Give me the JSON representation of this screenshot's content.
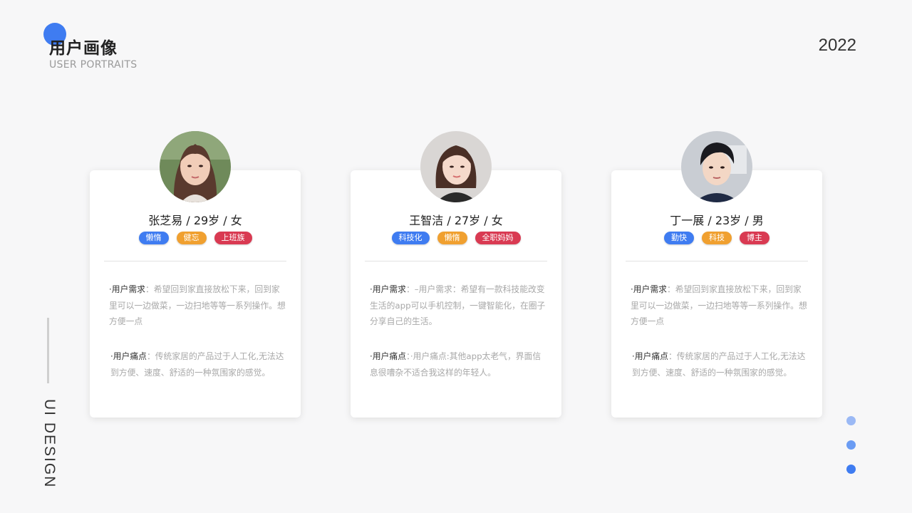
{
  "header": {
    "title": "用户画像",
    "subtitle": "USER PORTRAITS",
    "year": "2022",
    "accent_color": "#3f7cf1"
  },
  "side": {
    "label": "UI DESIGN"
  },
  "nav_dots": [
    {
      "color": "#9bb9f5"
    },
    {
      "color": "#6b9cf3"
    },
    {
      "color": "#3f7cf1"
    }
  ],
  "cards": [
    {
      "name": "张芝易 / 29岁 / 女",
      "avatar": "portrait-woman-long-hair",
      "tags": [
        {
          "label": "懒惰",
          "color": "#3f7cf1"
        },
        {
          "label": "健忘",
          "color": "#f0a030"
        },
        {
          "label": "上班族",
          "color": "#d93a52"
        }
      ],
      "needs": {
        "label": "·用户需求",
        "text": "：希望回到家直接放松下来，回到家里可以一边做菜，一边扫地等等一系列操作。想方便一点"
      },
      "pain": {
        "label": "·用户痛点",
        "text": "：传统家居的产品过于人工化,无法达到方便、速度、舒适的一种氛围家的感觉。"
      }
    },
    {
      "name": "王智洁 / 27岁 / 女",
      "avatar": "portrait-woman-short-hair",
      "tags": [
        {
          "label": "科技化",
          "color": "#3f7cf1"
        },
        {
          "label": "懒惰",
          "color": "#f0a030"
        },
        {
          "label": "全职妈妈",
          "color": "#d93a52"
        }
      ],
      "needs": {
        "label": "·用户需求",
        "text": "：–用户需求：希望有一款科技能改变生活的app可以手机控制，一键智能化，在圈子分享自己的生活。"
      },
      "pain": {
        "label": "·用户痛点",
        "text": "：·用户痛点:其他app太老气，界面信息很嘈杂不适合我这样的年轻人。"
      }
    },
    {
      "name": "丁一展 / 23岁 / 男",
      "avatar": "portrait-young-man",
      "tags": [
        {
          "label": "勤快",
          "color": "#3f7cf1"
        },
        {
          "label": "科技",
          "color": "#f0a030"
        },
        {
          "label": "博主",
          "color": "#d93a52"
        }
      ],
      "needs": {
        "label": "·用户需求",
        "text": "：希望回到家直接放松下来，回到家里可以一边做菜，一边扫地等等一系列操作。想方便一点"
      },
      "pain": {
        "label": "·用户痛点",
        "text": "：传统家居的产品过于人工化,无法达到方便、速度、舒适的一种氛围家的感觉。"
      }
    }
  ]
}
